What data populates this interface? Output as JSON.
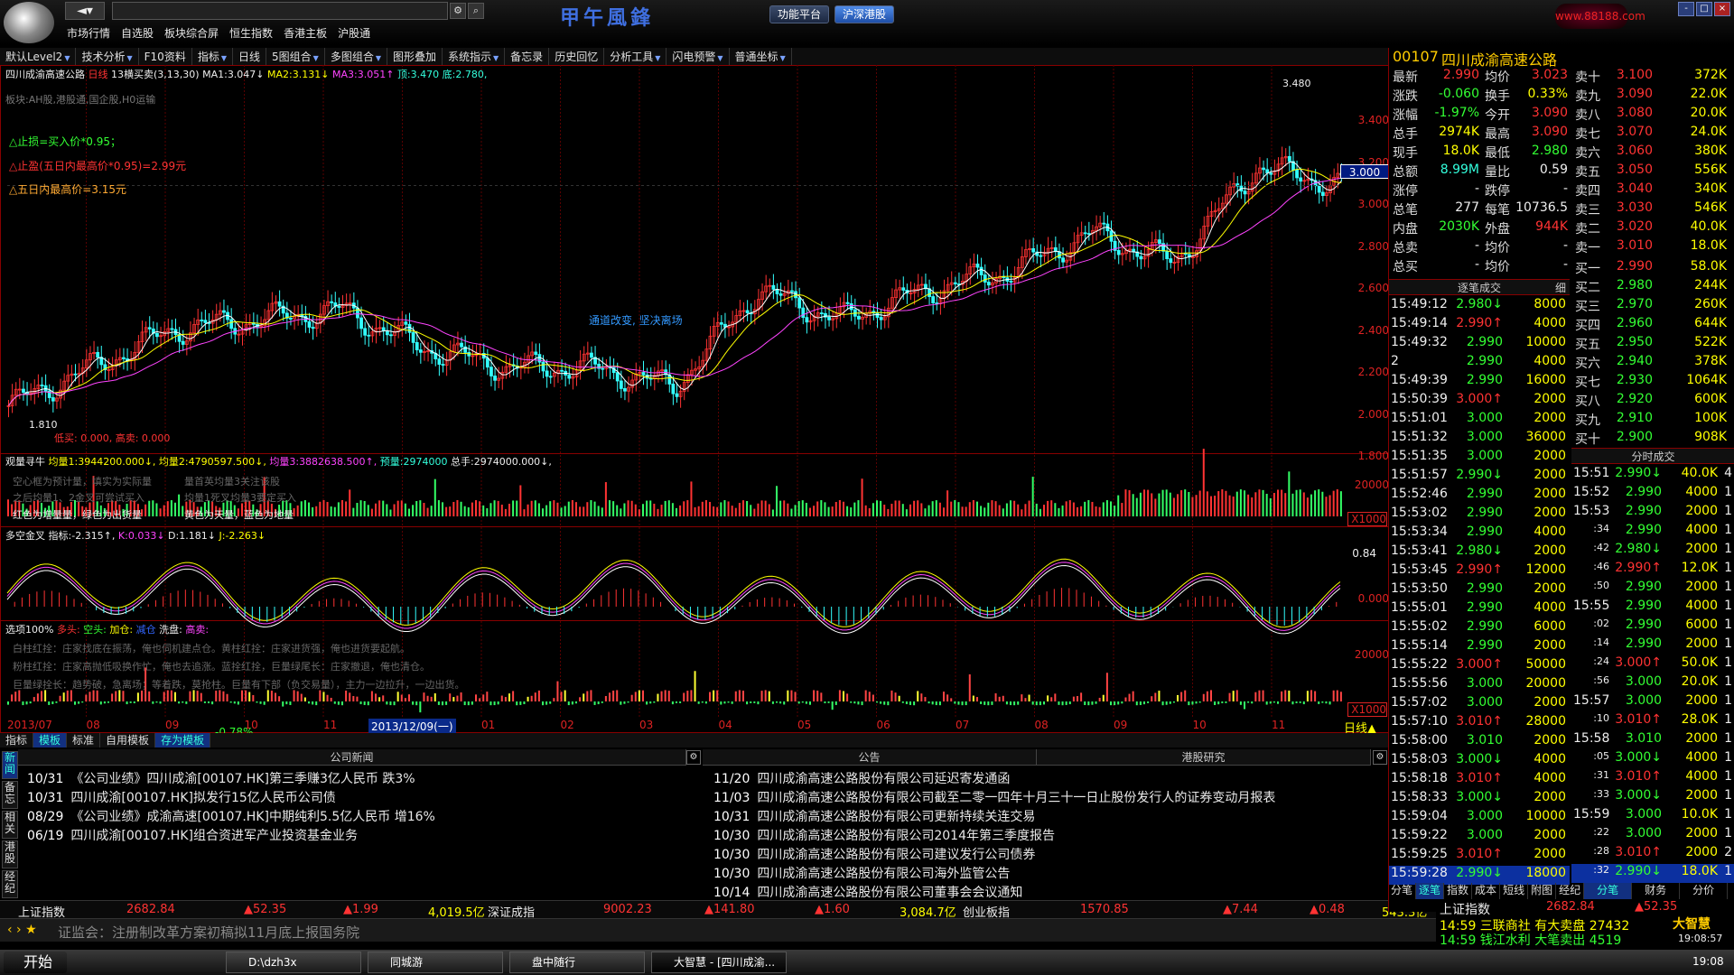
{
  "app": {
    "top_menu": [
      "市场行情",
      "自选股",
      "板块综合屏",
      "恒生指数",
      "香港主板",
      "沪股通"
    ],
    "brand": "甲午風鋒",
    "func_btn": "功能平台",
    "gangu_btn": "沪深港股",
    "nav": "◄▾",
    "win_logo": "www.88188.com",
    "win_ctl": [
      "-",
      "□",
      "×"
    ]
  },
  "toolbar": [
    "默认Level2",
    "技术分析",
    "F10资料",
    "指标",
    "日线",
    "5图组合",
    "多图组合",
    "图形叠加",
    "系统指示",
    "备忘录",
    "历史回忆",
    "分析工具",
    "闪电预警",
    "普通坐标"
  ],
  "toolbar_dd": [
    1,
    1,
    0,
    1,
    0,
    1,
    1,
    0,
    1,
    0,
    0,
    1,
    1,
    1
  ],
  "rtools": [
    "测",
    "标",
    "⊞",
    "权",
    "线",
    "移",
    "☐",
    "▣"
  ],
  "main_chart": {
    "title": "四川成渝高速公路",
    "period": "日线",
    "mode": "13横买卖(3,13,30)",
    "ma1_label": "MA1:",
    "ma1": "3.047↓",
    "ma2_label": "MA2:",
    "ma2": "3.131↓",
    "ma3_label": "MA3:",
    "ma3": "3.051↑",
    "top_label": "顶:",
    "top": "3.470",
    "bot_label": "底:",
    "bot": "2.780,",
    "sector": "板块:AH股,港股通,国企股,H0运输",
    "stop1": "△止损=买入价*0.95；",
    "stop2": "△止盈(五日内最高价*0.95)=2.99元",
    "stop3": "△五日内最高价=3.15元",
    "annotation": "通道改变, 坚决离场",
    "low_lab": "低买: 0.000,",
    "high_lab": "高卖: 0.000",
    "hi_mark": "3.480",
    "lo_mark": "1.810",
    "cur_price": "3.000",
    "yaxis": [
      "3.400",
      "3.200",
      "3.000",
      "2.800",
      "2.600",
      "2.400",
      "2.200",
      "2.000",
      "1.800"
    ]
  },
  "vol_chart": {
    "name": "观量寻牛",
    "avg1_l": "均量1:",
    "avg1": "3944200.000↓,",
    "avg2_l": "均量2:",
    "avg2": "4790597.500↓,",
    "avg3_l": "均量3:",
    "avg3": "3882638.500↑,",
    "pre_l": "预量:",
    "pre": "2974000",
    "tot_l": "总手:",
    "tot": "2974000.000↓,",
    "hint1": "空心框为预计量，填实为实际量",
    "hint2": "量首英均量3关注该股",
    "hint3": "之后均量1、2金叉可尝试买入",
    "hint4": "均量1死叉均量3要定买入",
    "hint5": "红色为增量量，绿色为出货量",
    "hint6": "黄色为天量，蓝色为地量",
    "yaxis": [
      "20000"
    ],
    "x1000": "X1000"
  },
  "kdj_chart": {
    "name": "多空金叉",
    "ind_l": "指标:",
    "ind": "-2.315↑,",
    "k_l": "K:",
    "k": "0.033↓",
    "d_l": "D:",
    "d": "1.181↓",
    "j_l": "J:",
    "j": "-2.263↓",
    "yaxis": [
      "0.84",
      "0.000"
    ]
  },
  "flow_chart": {
    "name": "选项100%",
    "labels": [
      "多头:",
      "空头:",
      "加仓:",
      "减仓",
      "洗盘:",
      "高卖:"
    ],
    "hint1": "白柱红拴：庄家找底在振荡，俺也伺机建点仓。黄柱红拴：庄家进货强，俺也进货要起航。",
    "hint2": "粉柱红拴：庄家高抛低吸换作忙，俺也去追涨。蓝拴红拴，巨量绿尾长：庄家撤退，俺也清仓。",
    "hint3": "巨量绿拴长：趋势破，急离场；等着跌，莫抢柱。巨量有下部（负交易量），主力一边拉升，一边出货。",
    "yaxis": [
      "20000"
    ],
    "x1000": "X1000"
  },
  "date_axis": {
    "labels": [
      "2013/07",
      "08",
      "09",
      "10",
      "11",
      "12",
      "01",
      "02",
      "03",
      "04",
      "05",
      "06",
      "07",
      "08",
      "09",
      "10",
      "11"
    ],
    "cur": "2013/12/09(一)",
    "mark": "-0.78%",
    "period": "日线▲"
  },
  "bottom_tabs": [
    "指标",
    "模板",
    "标准",
    "自用模板",
    "存为模板"
  ],
  "news": {
    "left_head": "公司新闻",
    "mid_head": "公告",
    "right_head": "港股研究",
    "vtabs": [
      "新闻",
      "备忘",
      "相关",
      "港股",
      "经纪"
    ],
    "left": [
      {
        "d": "10/31",
        "t": "《公司业绩》四川成渝[00107.HK]第三季赚3亿人民币 跌3%"
      },
      {
        "d": "10/31",
        "t": "四川成渝[00107.HK]拟发行15亿人民币公司债"
      },
      {
        "d": "08/29",
        "t": "《公司业绩》成渝高速[00107.HK]中期纯利5.5亿人民币 增16%"
      },
      {
        "d": "06/19",
        "t": "四川成渝[00107.HK]组合资进军产业投资基金业务"
      }
    ],
    "right": [
      {
        "d": "11/20",
        "t": "四川成渝高速公路股份有限公司延迟寄发通函"
      },
      {
        "d": "11/03",
        "t": "四川成渝高速公路股份有限公司截至二零一四年十月三十一日止股份发行人的证券变动月报表"
      },
      {
        "d": "10/31",
        "t": "四川成渝高速公路股份有限公司更新持续关连交易"
      },
      {
        "d": "10/30",
        "t": "四川成渝高速公路股份有限公司2014年第三季度报告"
      },
      {
        "d": "10/30",
        "t": "四川成渝高速公路股份有限公司建议发行公司债券"
      },
      {
        "d": "10/30",
        "t": "四川成渝高速公路股份有限公司海外监管公告"
      },
      {
        "d": "10/14",
        "t": "四川成渝高速公路股份有限公司董事会会议通知"
      }
    ]
  },
  "index_bar": {
    "sh_name": "上证指数",
    "sh_val": "2682.84",
    "sh_chg": "▲52.35",
    "sh_pct": "▲1.99",
    "sh_amt": "4,019.5亿",
    "sz_name": "深证成指",
    "sz_val": "9002.23",
    "sz_chg": "▲141.80",
    "sz_pct": "▲1.60",
    "sz_amt": "3,084.7亿",
    "cy_name": "创业板指",
    "cy_val": "1570.85",
    "cy_chg": "▲7.44",
    "cy_pct": "▲0.48",
    "cy_amt": "543.3亿"
  },
  "ticker": "证监会：注册制改革方案初稿拟11月底上报国务院",
  "rb2": {
    "idx_name": "上证指数",
    "idx_val": "2682.84",
    "idx_chg": "▲52.35",
    "l1": "14:59 三联商社 有大卖盘 27432",
    "l2": "14:59 钱江水利 大笔卖出 4519",
    "logo": "大智慧",
    "time": "19:08:57"
  },
  "taskbar": {
    "start": "开始",
    "tasks": [
      "D:\\dzh3x",
      "同城游",
      "盘中随行",
      "大智慧 - [四川成渝..."
    ],
    "clock": "19:08"
  },
  "quote": {
    "code": "00107",
    "name": "四川成渝高速公路",
    "rows": [
      {
        "k": "最新",
        "v": "2.990",
        "c": "r",
        "k2": "均价",
        "v2": "3.023",
        "c2": "r"
      },
      {
        "k": "涨跌",
        "v": "-0.060",
        "c": "g",
        "k2": "换手",
        "v2": "0.33%",
        "c2": "y"
      },
      {
        "k": "涨幅",
        "v": "-1.97%",
        "c": "g",
        "k2": "今开",
        "v2": "3.090",
        "c2": "r"
      },
      {
        "k": "总手",
        "v": "2974K",
        "c": "y",
        "k2": "最高",
        "v2": "3.090",
        "c2": "r"
      },
      {
        "k": "现手",
        "v": "18.0K",
        "c": "y",
        "k2": "最低",
        "v2": "2.980",
        "c2": "g"
      },
      {
        "k": "总额",
        "v": "8.99M",
        "c": "c",
        "k2": "量比",
        "v2": "0.59",
        "c2": "w"
      },
      {
        "k": "涨停",
        "v": "-",
        "c": "w",
        "k2": "跌停",
        "v2": "-",
        "c2": "w"
      },
      {
        "k": "总笔",
        "v": "277",
        "c": "w",
        "k2": "每笔",
        "v2": "10736.5",
        "c2": "w"
      },
      {
        "k": "内盘",
        "v": "2030K",
        "c": "g",
        "k2": "外盘",
        "v2": "944K",
        "c2": "r"
      },
      {
        "k": "总卖",
        "v": "-",
        "c": "w",
        "k2": "均价",
        "v2": "-",
        "c2": "w"
      },
      {
        "k": "总买",
        "v": "-",
        "c": "w",
        "k2": "均价",
        "v2": "-",
        "c2": "w"
      }
    ],
    "asks": [
      {
        "k": "卖十",
        "p": "3.100",
        "v": "372K"
      },
      {
        "k": "卖九",
        "p": "3.090",
        "v": "22.0K"
      },
      {
        "k": "卖八",
        "p": "3.080",
        "v": "20.0K"
      },
      {
        "k": "卖七",
        "p": "3.070",
        "v": "24.0K"
      },
      {
        "k": "卖六",
        "p": "3.060",
        "v": "380K"
      },
      {
        "k": "卖五",
        "p": "3.050",
        "v": "556K"
      },
      {
        "k": "卖四",
        "p": "3.040",
        "v": "340K"
      },
      {
        "k": "卖三",
        "p": "3.030",
        "v": "546K"
      },
      {
        "k": "卖二",
        "p": "3.020",
        "v": "40.0K"
      },
      {
        "k": "卖一",
        "p": "3.010",
        "v": "18.0K"
      }
    ],
    "bids": [
      {
        "k": "买一",
        "p": "2.990",
        "v": "58.0K"
      },
      {
        "k": "买二",
        "p": "2.980",
        "v": "244K"
      },
      {
        "k": "买三",
        "p": "2.970",
        "v": "260K"
      },
      {
        "k": "买四",
        "p": "2.960",
        "v": "644K"
      },
      {
        "k": "买五",
        "p": "2.950",
        "v": "522K"
      },
      {
        "k": "买六",
        "p": "2.940",
        "v": "378K"
      },
      {
        "k": "买七",
        "p": "2.930",
        "v": "1064K"
      },
      {
        "k": "买八",
        "p": "2.920",
        "v": "600K"
      },
      {
        "k": "买九",
        "p": "2.910",
        "v": "100K"
      },
      {
        "k": "买十",
        "p": "2.900",
        "v": "908K"
      }
    ]
  },
  "trades_head": "逐笔成交",
  "trades_detail": "细",
  "trades": [
    {
      "t": "15:49:12",
      "p": "2.980↓",
      "c": "g",
      "v": "8000"
    },
    {
      "t": "15:49:14",
      "p": "2.990↑",
      "c": "r",
      "v": "4000"
    },
    {
      "t": "15:49:32",
      "p": "2.990",
      "c": "g",
      "v": "10000"
    },
    {
      "t": "2",
      "p": "2.990",
      "c": "g",
      "v": "4000"
    },
    {
      "t": "15:49:39",
      "p": "2.990",
      "c": "g",
      "v": "16000"
    },
    {
      "t": "15:50:39",
      "p": "3.000↑",
      "c": "r",
      "v": "2000"
    },
    {
      "t": "15:51:01",
      "p": "3.000",
      "c": "g",
      "v": "2000"
    },
    {
      "t": "15:51:32",
      "p": "3.000",
      "c": "g",
      "v": "36000"
    },
    {
      "t": "15:51:35",
      "p": "3.000",
      "c": "g",
      "v": "2000"
    },
    {
      "t": "15:51:57",
      "p": "2.990↓",
      "c": "g",
      "v": "2000"
    },
    {
      "t": "15:52:46",
      "p": "2.990",
      "c": "g",
      "v": "2000"
    },
    {
      "t": "15:53:02",
      "p": "2.990",
      "c": "g",
      "v": "2000"
    },
    {
      "t": "15:53:34",
      "p": "2.990",
      "c": "g",
      "v": "4000"
    },
    {
      "t": "15:53:41",
      "p": "2.980↓",
      "c": "g",
      "v": "2000"
    },
    {
      "t": "15:53:45",
      "p": "2.990↑",
      "c": "r",
      "v": "12000"
    },
    {
      "t": "15:53:50",
      "p": "2.990",
      "c": "g",
      "v": "2000"
    },
    {
      "t": "15:55:01",
      "p": "2.990",
      "c": "g",
      "v": "4000"
    },
    {
      "t": "15:55:02",
      "p": "2.990",
      "c": "g",
      "v": "6000"
    },
    {
      "t": "15:55:14",
      "p": "2.990",
      "c": "g",
      "v": "2000"
    },
    {
      "t": "15:55:22",
      "p": "3.000↑",
      "c": "r",
      "v": "50000"
    },
    {
      "t": "15:55:56",
      "p": "3.000",
      "c": "g",
      "v": "20000"
    },
    {
      "t": "15:57:02",
      "p": "3.000",
      "c": "g",
      "v": "2000"
    },
    {
      "t": "15:57:10",
      "p": "3.010↑",
      "c": "r",
      "v": "28000"
    },
    {
      "t": "15:58:00",
      "p": "3.010",
      "c": "g",
      "v": "2000"
    },
    {
      "t": "15:58:03",
      "p": "3.000↓",
      "c": "g",
      "v": "4000"
    },
    {
      "t": "15:58:18",
      "p": "3.010↑",
      "c": "r",
      "v": "4000"
    },
    {
      "t": "15:58:33",
      "p": "3.000↓",
      "c": "g",
      "v": "2000"
    },
    {
      "t": "15:59:04",
      "p": "3.000",
      "c": "g",
      "v": "10000"
    },
    {
      "t": "15:59:22",
      "p": "3.000",
      "c": "g",
      "v": "2000"
    },
    {
      "t": "15:59:25",
      "p": "3.010↑",
      "c": "r",
      "v": "2000"
    },
    {
      "t": "15:59:28",
      "p": "2.990↓",
      "c": "g",
      "v": "18000"
    }
  ],
  "min_head": "分时成交",
  "min_trades": [
    {
      "t": "15:51",
      "p": "2.990↓",
      "c": "g",
      "v": "40.0K",
      "n": "4"
    },
    {
      "t": "15:52",
      "p": "2.990",
      "c": "g",
      "v": "4000",
      "n": "1"
    },
    {
      "t": "15:53",
      "p": "2.990",
      "c": "g",
      "v": "2000",
      "n": "1"
    },
    {
      "t": ":34",
      "p": "2.990",
      "c": "g",
      "v": "4000",
      "n": "1"
    },
    {
      "t": ":42",
      "p": "2.980↓",
      "c": "g",
      "v": "2000",
      "n": "1"
    },
    {
      "t": ":46",
      "p": "2.990↑",
      "c": "r",
      "v": "12.0K",
      "n": "1"
    },
    {
      "t": ":50",
      "p": "2.990",
      "c": "g",
      "v": "2000",
      "n": "1"
    },
    {
      "t": "15:55",
      "p": "2.990",
      "c": "g",
      "v": "4000",
      "n": "1"
    },
    {
      "t": ":02",
      "p": "2.990",
      "c": "g",
      "v": "6000",
      "n": "1"
    },
    {
      "t": ":14",
      "p": "2.990",
      "c": "g",
      "v": "2000",
      "n": "1"
    },
    {
      "t": ":24",
      "p": "3.000↑",
      "c": "r",
      "v": "50.0K",
      "n": "1"
    },
    {
      "t": ":56",
      "p": "3.000",
      "c": "g",
      "v": "20.0K",
      "n": "1"
    },
    {
      "t": "15:57",
      "p": "3.000",
      "c": "g",
      "v": "2000",
      "n": "1"
    },
    {
      "t": ":10",
      "p": "3.010↑",
      "c": "r",
      "v": "28.0K",
      "n": "1"
    },
    {
      "t": "15:58",
      "p": "3.010",
      "c": "g",
      "v": "2000",
      "n": "1"
    },
    {
      "t": ":05",
      "p": "3.000↓",
      "c": "g",
      "v": "4000",
      "n": "1"
    },
    {
      "t": ":31",
      "p": "3.010↑",
      "c": "r",
      "v": "4000",
      "n": "1"
    },
    {
      "t": ":33",
      "p": "3.000↓",
      "c": "g",
      "v": "2000",
      "n": "1"
    },
    {
      "t": "15:59",
      "p": "3.000",
      "c": "g",
      "v": "10.0K",
      "n": "1"
    },
    {
      "t": ":22",
      "p": "3.000",
      "c": "g",
      "v": "2000",
      "n": "1"
    },
    {
      "t": ":28",
      "p": "3.010↑",
      "c": "r",
      "v": "2000",
      "n": "2"
    },
    {
      "t": ":32",
      "p": "2.990↓",
      "c": "g",
      "v": "18.0K",
      "n": "1"
    }
  ],
  "rbtabs": [
    "分笔",
    "逐笔",
    "指数",
    "成本",
    "短线",
    "附图",
    "经纪"
  ],
  "rbtabs2": [
    "分笔",
    "财务",
    "分价"
  ],
  "chart_data": {
    "type": "line",
    "x": [
      "2013/07",
      "2013/08",
      "2013/09",
      "2013/10",
      "2013/11",
      "2013/12",
      "2014/01",
      "2014/02",
      "2014/03",
      "2014/04",
      "2014/05",
      "2014/06",
      "2014/07",
      "2014/08",
      "2014/09",
      "2014/10",
      "2014/11"
    ],
    "values": [
      1.85,
      2.05,
      2.25,
      2.3,
      2.35,
      2.15,
      2.05,
      2.05,
      1.95,
      2.45,
      2.3,
      2.45,
      2.55,
      2.75,
      2.6,
      3.1,
      3.0
    ],
    "ylim": [
      1.8,
      3.45
    ],
    "high": 3.48,
    "low": 1.81,
    "last": 3.0
  }
}
